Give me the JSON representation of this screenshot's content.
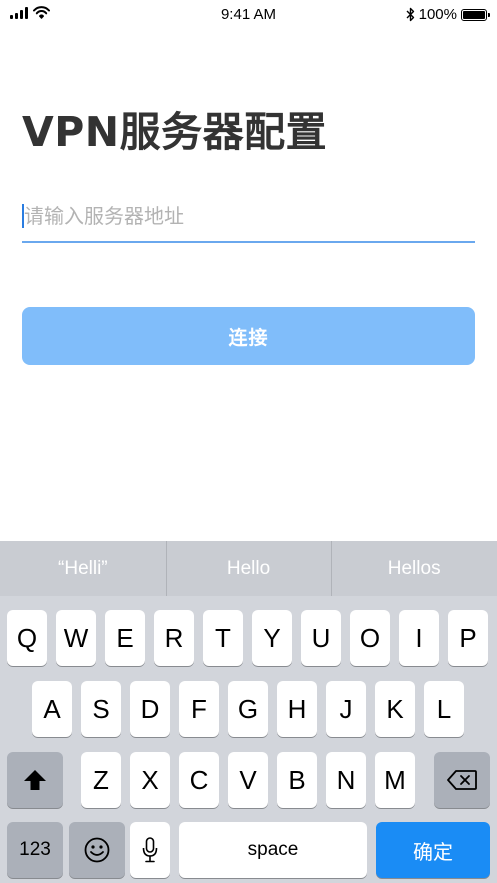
{
  "status_bar": {
    "time": "9:41 AM",
    "battery_percent": "100%",
    "battery_level": 1.0
  },
  "main": {
    "title": "VPN服务器配置",
    "server_input": {
      "value": "",
      "placeholder": "请输入服务器地址"
    },
    "connect_label": "连接"
  },
  "keyboard": {
    "suggestions": [
      "“Helli”",
      "Hello",
      "Hellos"
    ],
    "row1": [
      "Q",
      "W",
      "E",
      "R",
      "T",
      "Y",
      "U",
      "O",
      "I",
      "P"
    ],
    "row2": [
      "A",
      "S",
      "D",
      "F",
      "G",
      "H",
      "J",
      "K",
      "L"
    ],
    "row3": [
      "Z",
      "X",
      "C",
      "V",
      "B",
      "N",
      "M"
    ],
    "numbers_label": "123",
    "space_label": "space",
    "return_label": "确定"
  },
  "colors": {
    "accent": "#80bdfa",
    "underline": "#6aa8ee",
    "return_key": "#1a8cf5"
  }
}
